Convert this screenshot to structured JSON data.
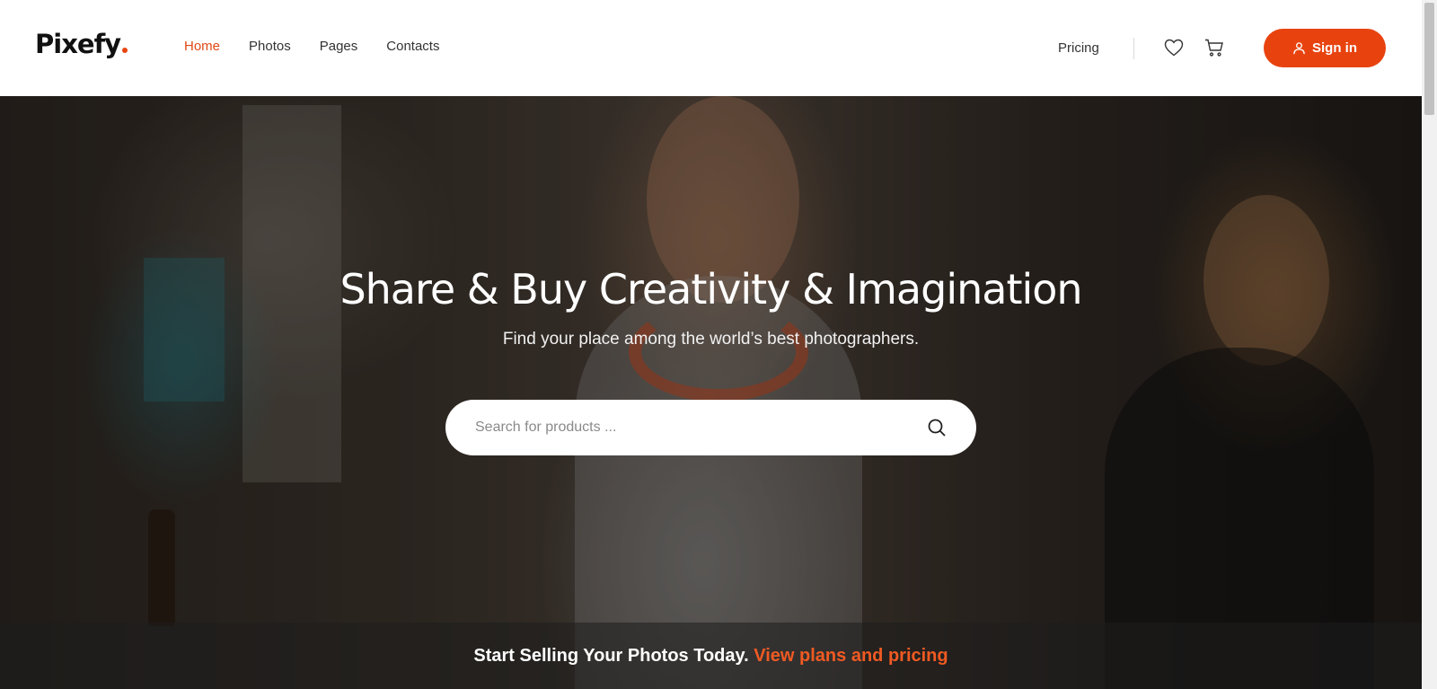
{
  "brand": {
    "name": "Pixefy",
    "accent": "#e8430f"
  },
  "nav": {
    "items": [
      {
        "label": "Home",
        "active": true
      },
      {
        "label": "Photos",
        "active": false
      },
      {
        "label": "Pages",
        "active": false
      },
      {
        "label": "Contacts",
        "active": false
      }
    ],
    "pricing": "Pricing",
    "icons": [
      "heart-icon",
      "cart-icon",
      "user-icon"
    ],
    "signin_label": "Sign in"
  },
  "hero": {
    "title": "Share & Buy Creativity & Imagination",
    "subtitle": "Find your place among the world’s best photographers.",
    "search_placeholder": "Search for products ...",
    "search_value": ""
  },
  "promo": {
    "text": "Start Selling Your Photos Today. ",
    "link": "View plans and pricing"
  }
}
